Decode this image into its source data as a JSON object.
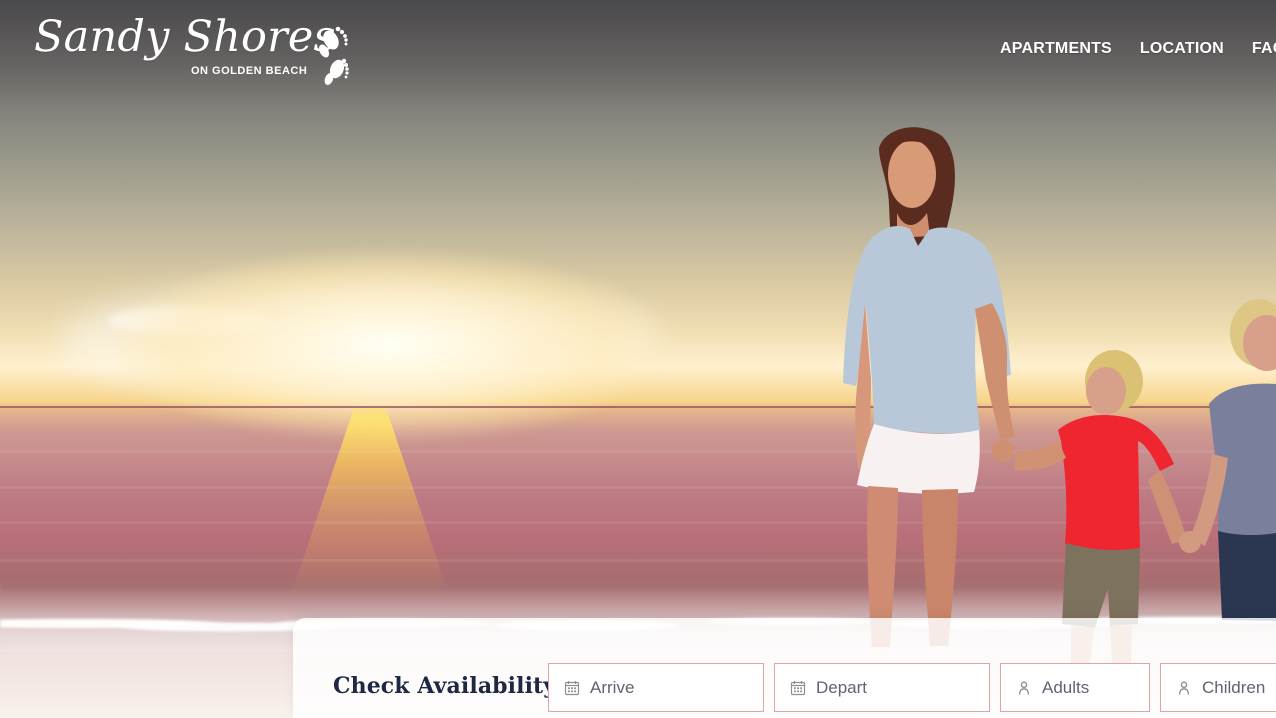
{
  "brand": {
    "name": "Sandy Shores",
    "subtitle": "ON GOLDEN BEACH"
  },
  "nav": {
    "items": [
      "APARTMENTS",
      "LOCATION",
      "FACI"
    ]
  },
  "booking": {
    "title": "Check Availability",
    "fields": {
      "arrive": "Arrive",
      "depart": "Depart",
      "adults": "Adults",
      "children": "Children"
    }
  },
  "icons": {
    "logo": "footprints-icon",
    "arrive": "calendar-icon",
    "depart": "calendar-icon",
    "adults": "person-icon",
    "children": "person-icon"
  },
  "colors": {
    "nav_text": "#ffffff",
    "booking_title": "#1d2842",
    "field_border": "#e3a4a1",
    "field_text": "#5f6470"
  }
}
